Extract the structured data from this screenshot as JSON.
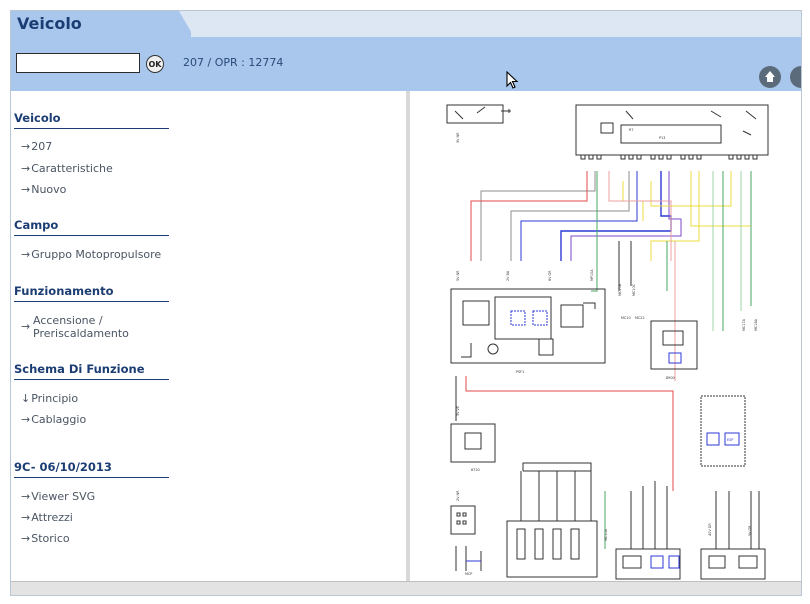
{
  "header": {
    "title": "Veicolo",
    "search_value": "",
    "ok_label": "OK",
    "breadcrumb": "207  /  OPR : 12774"
  },
  "sidebar": {
    "sections": [
      {
        "title": "Veicolo",
        "items": [
          "207",
          "Caratteristiche",
          "Nuovo"
        ]
      },
      {
        "title": "Campo",
        "items": [
          "Gruppo Motopropulsore"
        ]
      },
      {
        "title": "Funzionamento",
        "items": [
          "Accensione / Preriscaldamento"
        ]
      },
      {
        "title": "Schema Di Funzione",
        "items": [
          "Principio",
          "Cablaggio"
        ]
      },
      {
        "title": "9C- 06/10/2013",
        "items": [
          "Viewer SVG",
          "Attrezzi",
          "Storico"
        ]
      }
    ]
  },
  "icons": {
    "item_arrow": "right-arrow",
    "active_item_arrow": "down-arrow",
    "home": "home-icon",
    "cursor": "mouse-pointer"
  },
  "diagram": {
    "components": {
      "ecu_top": "R7",
      "ecu_top_sub": "P13",
      "module1": "PSF1",
      "module2": "8900",
      "module3": "8720",
      "module4": "8400",
      "connector_caption": "MCP",
      "esp_label": "ESP"
    },
    "wire_codes": [
      "3V NR",
      "2V BA",
      "5V NR",
      "6V GR",
      "3V VE",
      "40V GR",
      "2V NR",
      "5V GR"
    ],
    "connector_codes": [
      "MC10B",
      "MC10C",
      "MC10",
      "MC22",
      "MC17A",
      "MC18A",
      "MC10A",
      "MP10A"
    ]
  },
  "colors": {
    "header_bg": "#a9c7ec",
    "header_tab_bg": "#dde7f3",
    "title_color": "#1b3d73",
    "wire_red": "#e24a4a",
    "wire_blue": "#2d3ad6",
    "wire_yellow": "#e8dc3c",
    "wire_green": "#4aa763",
    "wire_purple": "#7d4ac9",
    "wire_gray": "#8e8e8e"
  }
}
